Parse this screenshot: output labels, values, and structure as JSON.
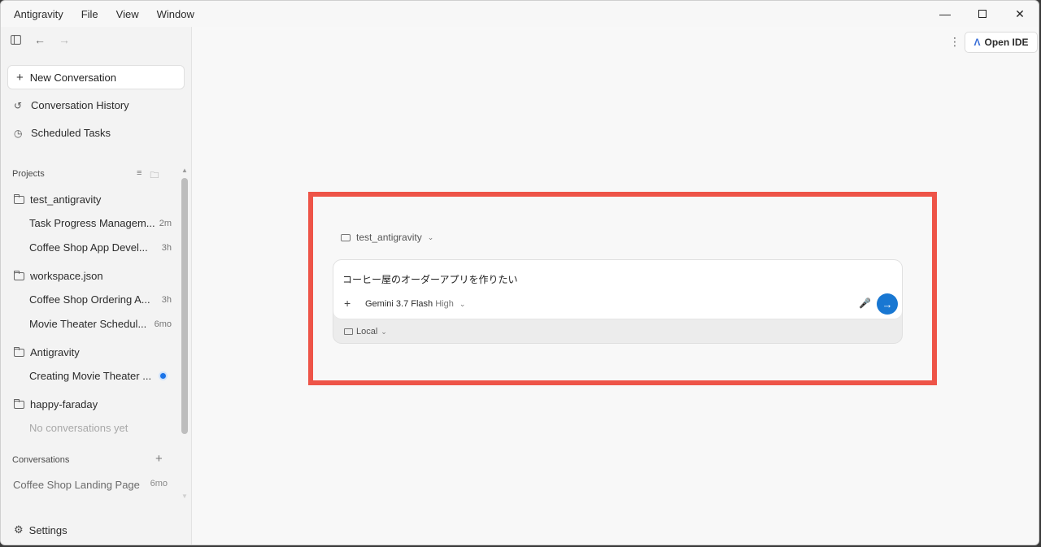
{
  "menu": [
    "Antigravity",
    "File",
    "View",
    "Window"
  ],
  "sidebar": {
    "new_conversation": "New Conversation",
    "history": "Conversation History",
    "scheduled": "Scheduled Tasks",
    "projects_label": "Projects",
    "projects": [
      {
        "name": "test_antigravity",
        "items": [
          {
            "title": "Task Progress Managem...",
            "age": "2m"
          },
          {
            "title": "Coffee Shop App Devel...",
            "age": "3h"
          }
        ]
      },
      {
        "name": "workspace.json",
        "items": [
          {
            "title": "Coffee Shop Ordering A...",
            "age": "3h"
          },
          {
            "title": "Movie Theater Schedul...",
            "age": "6mo"
          }
        ]
      },
      {
        "name": "Antigravity",
        "items": [
          {
            "title": "Creating Movie Theater ...",
            "age": ""
          }
        ]
      },
      {
        "name": "happy-faraday",
        "items": []
      }
    ],
    "no_conversations": "No conversations yet",
    "conversations_label": "Conversations",
    "conversations": [
      {
        "title": "Coffee Shop Landing Page",
        "age": "6mo"
      }
    ],
    "settings": "Settings"
  },
  "header": {
    "open_ide": "Open IDE"
  },
  "composer": {
    "workspace": "test_antigravity",
    "prompt": "コーヒー屋のオーダーアプリを作りたい",
    "model": "Gemini 3.7 Flash",
    "level": "High",
    "environment": "Local"
  },
  "colors": {
    "highlight": "#ee5448",
    "send_button": "#1877d2",
    "active_dot": "#1a73e8"
  }
}
